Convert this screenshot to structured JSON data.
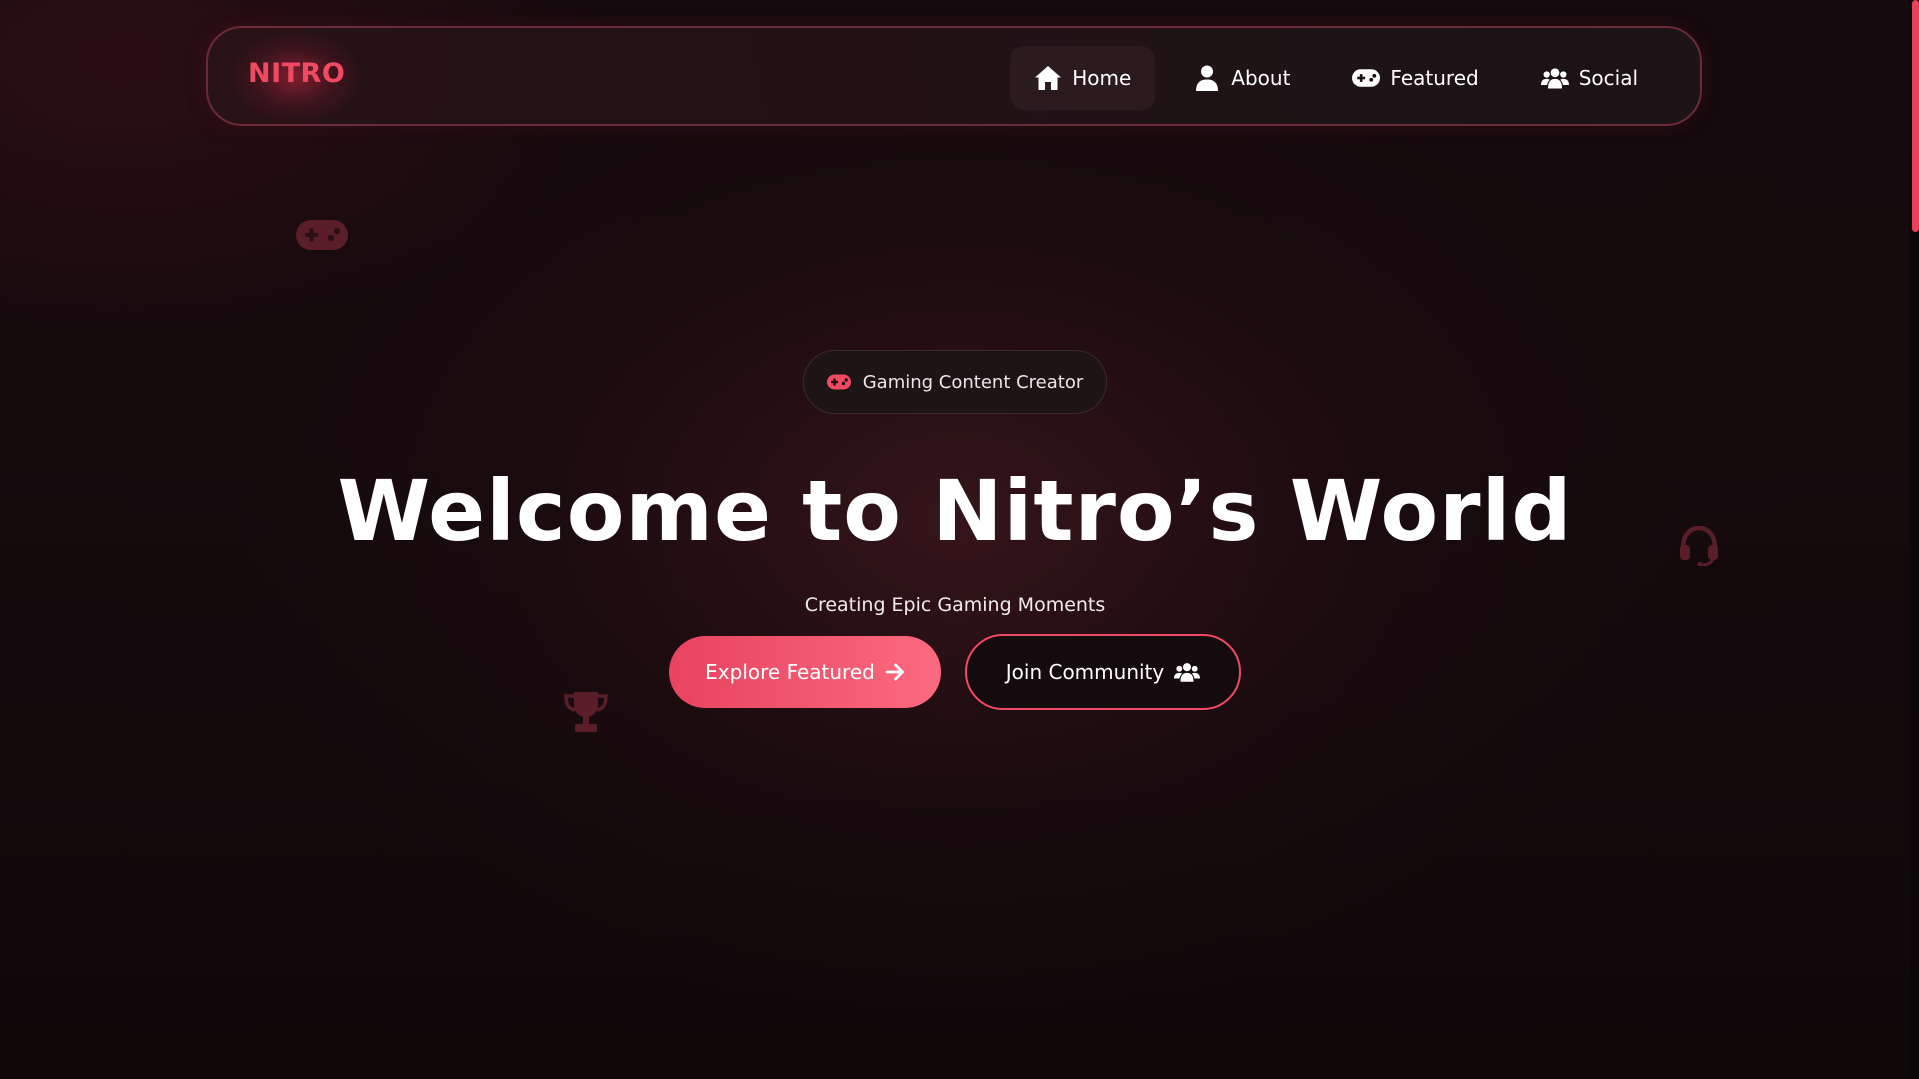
{
  "brand": {
    "logo": "NITRO"
  },
  "nav": {
    "items": [
      {
        "label": "Home",
        "icon": "home-icon",
        "active": true
      },
      {
        "label": "About",
        "icon": "user-icon",
        "active": false
      },
      {
        "label": "Featured",
        "icon": "gamepad-icon",
        "active": false
      },
      {
        "label": "Social",
        "icon": "users-icon",
        "active": false
      }
    ]
  },
  "hero": {
    "badge": {
      "label": "Gaming Content Creator",
      "icon": "gamepad-icon"
    },
    "title": "Welcome to Nitro’s World",
    "subtitle": "Creating Epic Gaming Moments",
    "primary_button": {
      "label": "Explore Featured",
      "icon": "arrow-right-icon"
    },
    "secondary_button": {
      "label": "Join Community",
      "icon": "users-icon"
    }
  },
  "decorations": [
    "gamepad-icon",
    "headset-icon",
    "trophy-icon"
  ],
  "colors": {
    "accent": "#f04a63",
    "accent_gradient_end": "#fb6a80",
    "background": "#150a0d",
    "nav_border": "#6b2a36",
    "deco_icon": "#5a1e28"
  }
}
